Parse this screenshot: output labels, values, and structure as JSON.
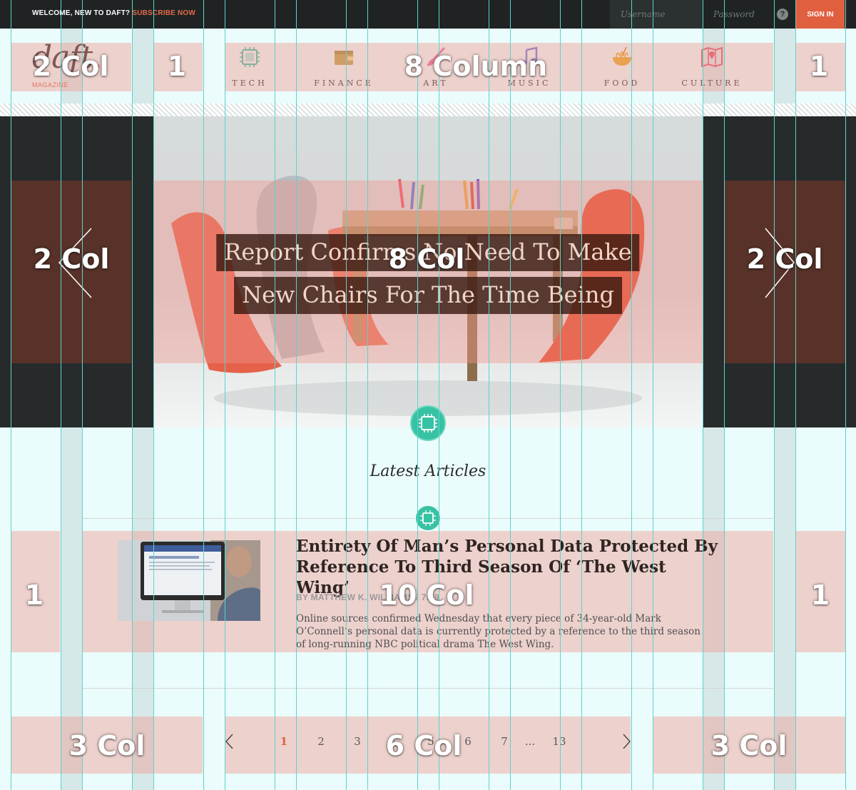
{
  "topbar": {
    "welcome": "WELCOME, NEW TO DAFT?",
    "subscribe_link": "SUBSCRIBE NOW",
    "username_placeholder": "Username",
    "password_placeholder": "Password",
    "help": "?",
    "signin_label": "SIGN IN"
  },
  "logo": {
    "name": "daft",
    "dot": ".",
    "subtitle": "MAGAZINE"
  },
  "nav": [
    {
      "label": "TECH",
      "icon": "chip-icon",
      "color": "#37c2a3"
    },
    {
      "label": "FINANCE",
      "icon": "wallet-icon",
      "color": "#b8a34a"
    },
    {
      "label": "ART",
      "icon": "paintbrush-icon",
      "color": "#e06aa0"
    },
    {
      "label": "MUSIC",
      "icon": "music-note-icon",
      "color": "#6b7ad0"
    },
    {
      "label": "FOOD",
      "icon": "noodle-bowl-icon",
      "color": "#e6a92a"
    },
    {
      "label": "CULTURE",
      "icon": "map-pin-icon",
      "color": "#e0526a"
    }
  ],
  "hero": {
    "title_line1": "Report Confirms No Need To Make",
    "title_line2": "New Chairs For The Time Being"
  },
  "section": {
    "title": "Latest Articles",
    "category_icon": "chip-icon"
  },
  "article": {
    "title": "Entirety Of Man’s Personal Data Protected By Reference To Third Season Of ‘The West Wing’",
    "meta": "BY MATTHEW K. WILLIAMS / 7:59",
    "excerpt": "Online sources confirmed Wednesday that every piece of 34-year-old Mark O’Connell’s personal data is currently protected by a reference to the third season of long-running NBC political drama The West Wing."
  },
  "pagination": {
    "pages": [
      "1",
      "2",
      "3",
      "5",
      "6",
      "7",
      "...",
      "13"
    ],
    "current": "1"
  },
  "annotations": {
    "header_logo": "2 Col",
    "header_left_gutter": "1",
    "header_nav": "8 Column",
    "header_right_gutter": "1",
    "hero_left": "2 Col",
    "hero_center": "8 Col",
    "hero_right": "2 Col",
    "article_left": "1",
    "article_center": "10 Col",
    "article_right": "1",
    "pager_left": "3 Col",
    "pager_center": "6 Col",
    "pager_right": "3 Col"
  },
  "colors": {
    "accent": "#e05f3f",
    "teal": "#37c2a3",
    "guide": "#5cd3cc",
    "dark_band": "#262a2b"
  }
}
